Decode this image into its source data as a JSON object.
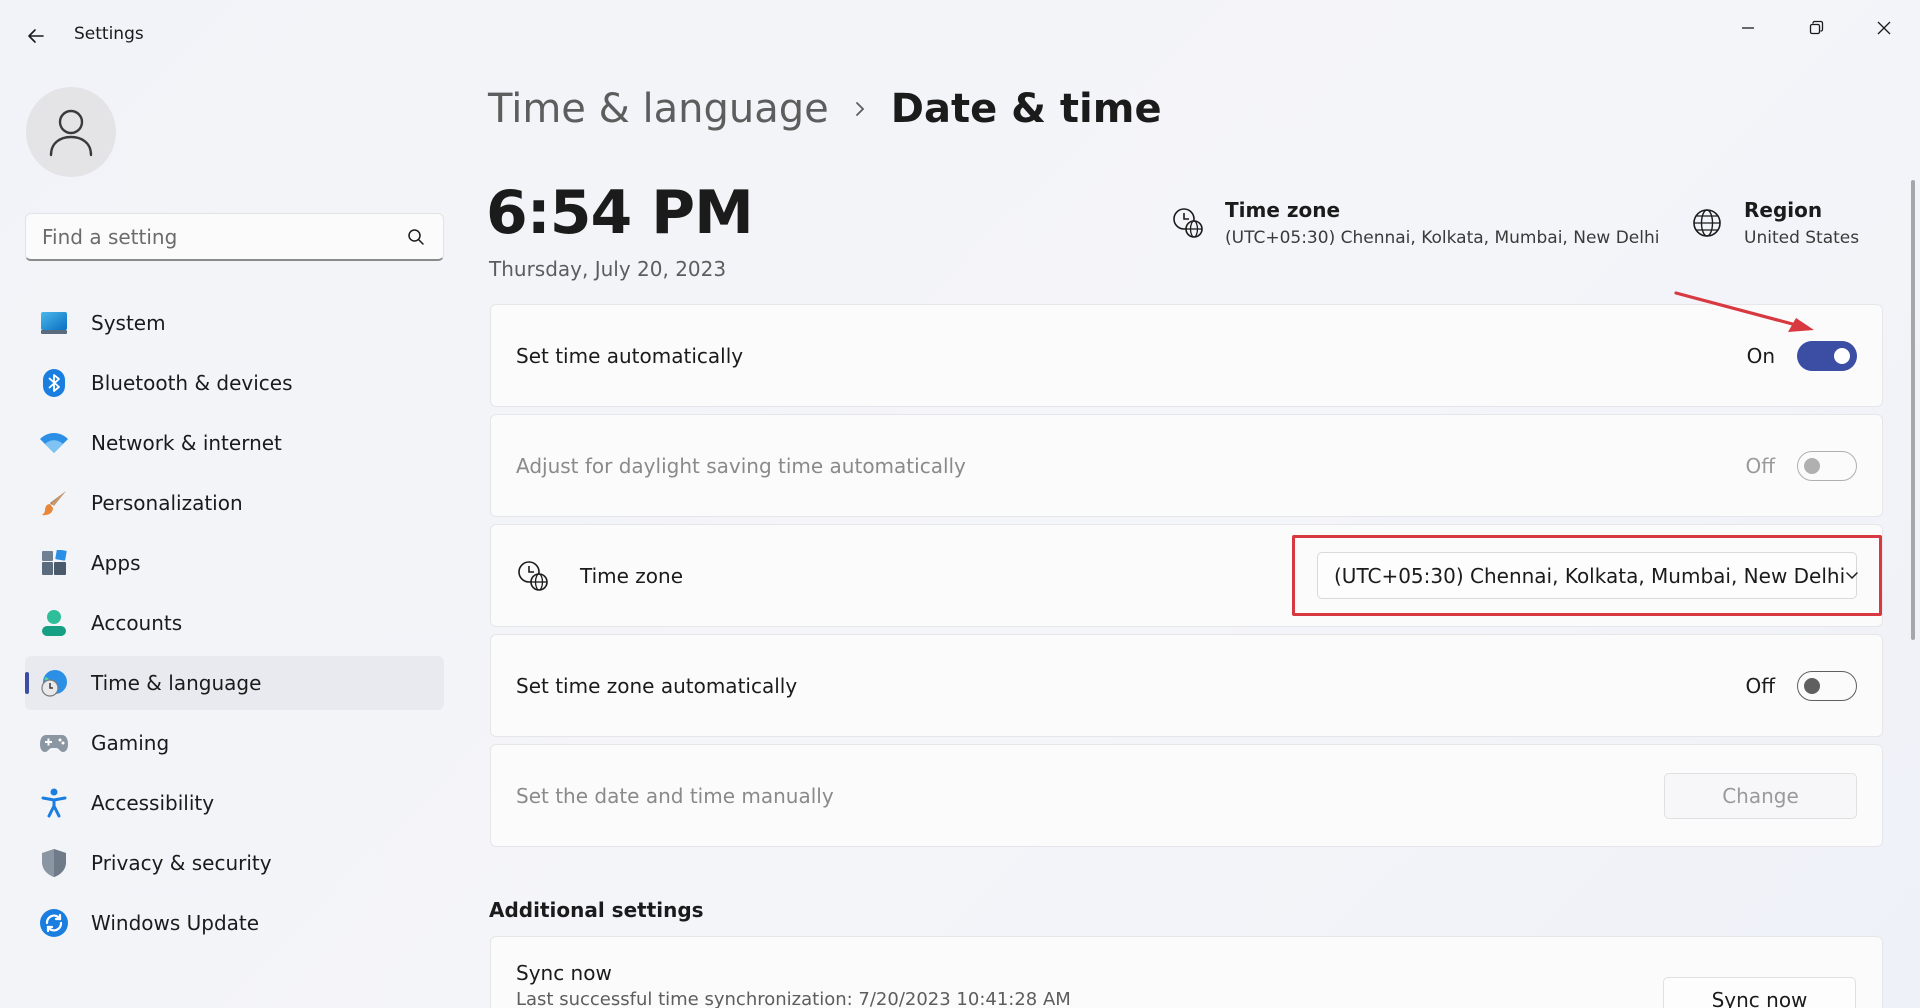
{
  "window": {
    "title": "Settings",
    "controls": [
      "minimize",
      "maximize",
      "close"
    ]
  },
  "sidebar": {
    "search": {
      "placeholder": "Find a setting",
      "value": ""
    },
    "items": [
      {
        "label": "System",
        "icon": "system-icon",
        "active": false
      },
      {
        "label": "Bluetooth & devices",
        "icon": "bluetooth-icon",
        "active": false
      },
      {
        "label": "Network & internet",
        "icon": "wifi-icon",
        "active": false
      },
      {
        "label": "Personalization",
        "icon": "paintbrush-icon",
        "active": false
      },
      {
        "label": "Apps",
        "icon": "apps-icon",
        "active": false
      },
      {
        "label": "Accounts",
        "icon": "accounts-icon",
        "active": true
      },
      {
        "label": "Time & language",
        "icon": "time-language-icon",
        "active": true
      },
      {
        "label": "Gaming",
        "icon": "gamepad-icon",
        "active": false
      },
      {
        "label": "Accessibility",
        "icon": "accessibility-icon",
        "active": false
      },
      {
        "label": "Privacy & security",
        "icon": "shield-icon",
        "active": false
      },
      {
        "label": "Windows Update",
        "icon": "update-icon",
        "active": false
      }
    ]
  },
  "header": {
    "parent": "Time & language",
    "current": "Date & time"
  },
  "clock": {
    "time": "6:54 PM",
    "date": "Thursday, July 20, 2023"
  },
  "info": {
    "timezone": {
      "title": "Time zone",
      "value": "(UTC+05:30) Chennai, Kolkata, Mumbai, New Delhi"
    },
    "region": {
      "title": "Region",
      "value": "United States"
    }
  },
  "settings": {
    "set_time_auto": {
      "label": "Set time automatically",
      "state": "On"
    },
    "daylight": {
      "label": "Adjust for daylight saving time automatically",
      "state": "Off"
    },
    "timezone": {
      "label": "Time zone",
      "selected": "(UTC+05:30) Chennai, Kolkata, Mumbai, New Delhi"
    },
    "timezone_auto": {
      "label": "Set time zone automatically",
      "state": "Off"
    },
    "manual": {
      "label": "Set the date and time manually",
      "button": "Change"
    }
  },
  "additional": {
    "title": "Additional settings",
    "sync": {
      "title": "Sync now",
      "subtitle": "Last successful time synchronization: 7/20/2023 10:41:28 AM",
      "button": "Sync now"
    }
  },
  "colors": {
    "accent": "#3c4ea4",
    "highlight": "#d8383f"
  }
}
